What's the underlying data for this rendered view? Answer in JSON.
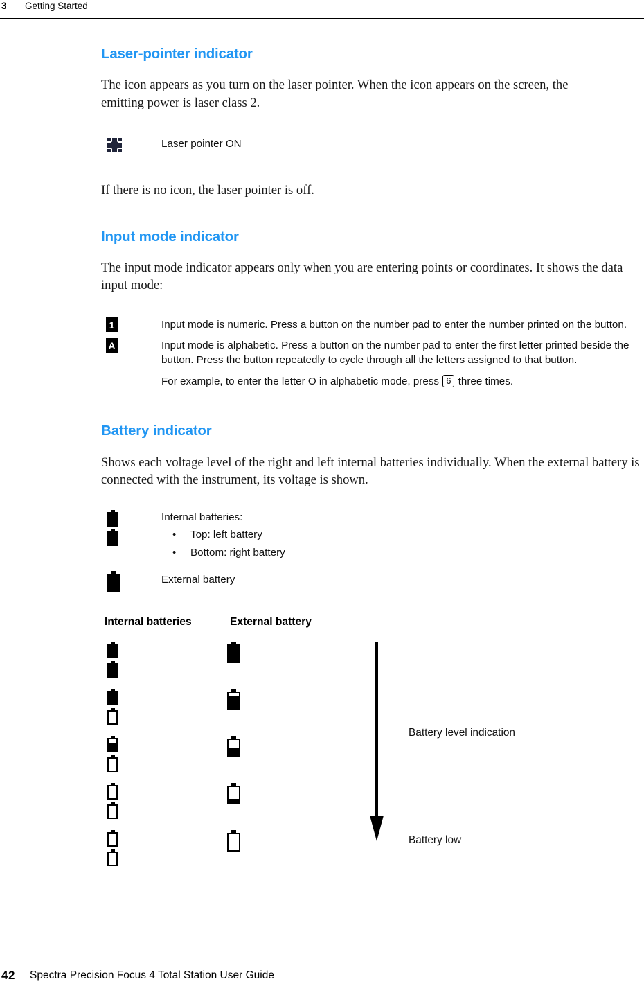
{
  "header": {
    "chapter_number": "3",
    "chapter_title": "Getting Started"
  },
  "sections": {
    "laser": {
      "heading": "Laser-pointer indicator",
      "intro": "The icon appears as you turn on the laser pointer. When the icon appears on the screen, the emitting power is laser class 2.",
      "icon_name": "laser-starburst-icon",
      "icon_label": "Laser pointer ON",
      "outro": "If there is no icon, the laser pointer is off."
    },
    "input_mode": {
      "heading": "Input mode indicator",
      "intro": "The input mode indicator appears only when you are entering points or coordinates. It shows the data input mode:",
      "rows": [
        {
          "badge": "1",
          "badge_icon_name": "numeric-mode-badge-icon",
          "text": "Input mode is numeric. Press a button on the number pad to enter the number printed on the button."
        },
        {
          "badge": "A",
          "badge_icon_name": "alphabetic-mode-badge-icon",
          "text": "Input mode is alphabetic. Press a button on the number pad to enter the first letter printed beside the button. Press the button repeatedly to cycle through all the letters assigned to that button."
        }
      ],
      "example_prefix": "For example, to enter the letter O in alphabetic mode, press",
      "example_key": "6",
      "example_suffix": "three times."
    },
    "battery": {
      "heading": "Battery indicator",
      "intro": "Shows each voltage level of the right and left internal batteries individually. When the external battery is connected with the instrument, its voltage is shown.",
      "internal_label": "Internal batteries:",
      "internal_bullets": [
        "Top: left battery",
        "Bottom: right battery"
      ],
      "external_label": "External battery"
    }
  },
  "chart_data": {
    "type": "table",
    "title": "Battery level indication",
    "columns": [
      "Internal batteries",
      "External battery"
    ],
    "annotations": {
      "arrow_top_label": "Battery level indication",
      "arrow_bottom_label": "Battery low",
      "arrow_direction": "down"
    },
    "rows": [
      {
        "internal_top_pct": 100,
        "internal_bottom_pct": 100,
        "external_pct": 100
      },
      {
        "internal_top_pct": 100,
        "internal_bottom_pct": 0,
        "external_pct": 75
      },
      {
        "internal_top_pct": 60,
        "internal_bottom_pct": 0,
        "external_pct": 50
      },
      {
        "internal_top_pct": 0,
        "internal_bottom_pct": 0,
        "external_pct": 25
      },
      {
        "internal_top_pct": 0,
        "internal_bottom_pct": 0,
        "external_pct": 0
      }
    ]
  },
  "footer": {
    "page_number": "42",
    "guide_title": "Spectra Precision Focus 4 Total Station User Guide"
  },
  "colors": {
    "heading_blue": "#2196f3",
    "text_black": "#111111",
    "icon_black": "#000000"
  }
}
